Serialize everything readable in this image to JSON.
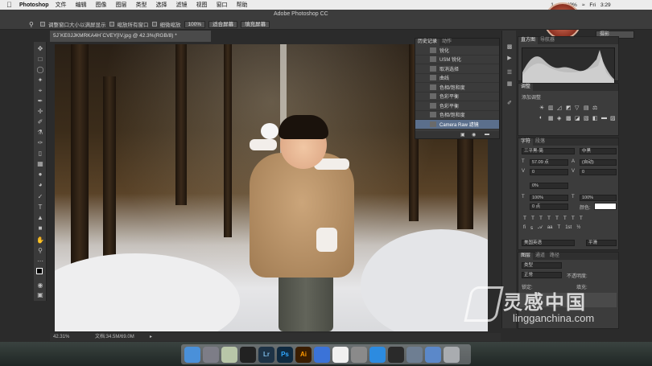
{
  "menubar": {
    "apple": "",
    "app_name": "Photoshop",
    "items": [
      "文件",
      "编辑",
      "图像",
      "图层",
      "类型",
      "选择",
      "滤镜",
      "视图",
      "窗口",
      "帮助"
    ],
    "status": [
      "1",
      "49%",
      "Fri"
    ],
    "clock": "3:29"
  },
  "window_title": "Adobe Photoshop CC",
  "options": {
    "opt1": "调整窗口大小以满屏显示",
    "opt2": "缩放所有窗口",
    "opt3": "细微缩放",
    "zoom": "100%",
    "fit_screen": "适合屏幕",
    "fill_screen": "填充屏幕",
    "workspace": "摄影"
  },
  "document_tab": "5J`KE0JJKMRKA4H`CVEY[IV.jpg @ 42.3%(RGB/8) *",
  "history_panel": {
    "tabs": [
      "历史记录",
      "动作"
    ],
    "items": [
      "锐化",
      "USM 锐化",
      "取消选择",
      "曲线",
      "色相/饱和度",
      "色彩平衡",
      "色彩平衡",
      "色相/饱和度",
      "Camera Raw 滤镜"
    ],
    "selected_index": 8
  },
  "histogram_panel": {
    "tabs": [
      "直方图",
      "导航器"
    ]
  },
  "adjust_panel": {
    "tabs": [
      "调整"
    ],
    "subtitle": "添加调整"
  },
  "char_panel": {
    "tabs": [
      "字符",
      "段落"
    ],
    "font": "三平黑-简",
    "style": "中黑",
    "size": "57.09 点",
    "leading": "(自动)",
    "kerning": "0",
    "tracking": "0",
    "baseline": "0%",
    "vscale": "100%",
    "hscale": "100%",
    "shift": "0 点",
    "color_label": "颜色:",
    "language": "美国英语",
    "aa": "平滑"
  },
  "layers_panel": {
    "tabs": [
      "图层",
      "通道",
      "路径"
    ],
    "kind": "类型",
    "blend": "正常",
    "opacity_label": "不透明度:",
    "lock_label": "锁定:",
    "fill_label": "填充:"
  },
  "status_bar": {
    "zoom": "42.31%",
    "doc_info": "文档:34.5M/69.0M"
  },
  "dock": {
    "labels": [
      "",
      "",
      "",
      "",
      "Lr",
      "Ps",
      "Ai",
      "",
      "",
      "",
      "",
      "",
      "",
      "",
      ""
    ]
  },
  "watermark": {
    "title": "灵感中国",
    "url": "lingganchina.com"
  },
  "colors": {
    "menubar": "#ececec",
    "panel": "#3c3c3c",
    "selection": "#5b6f8c",
    "ps_blue": "#31a8ff",
    "ai_orange": "#ff9a00",
    "lr_blue": "#7ab6e2"
  }
}
